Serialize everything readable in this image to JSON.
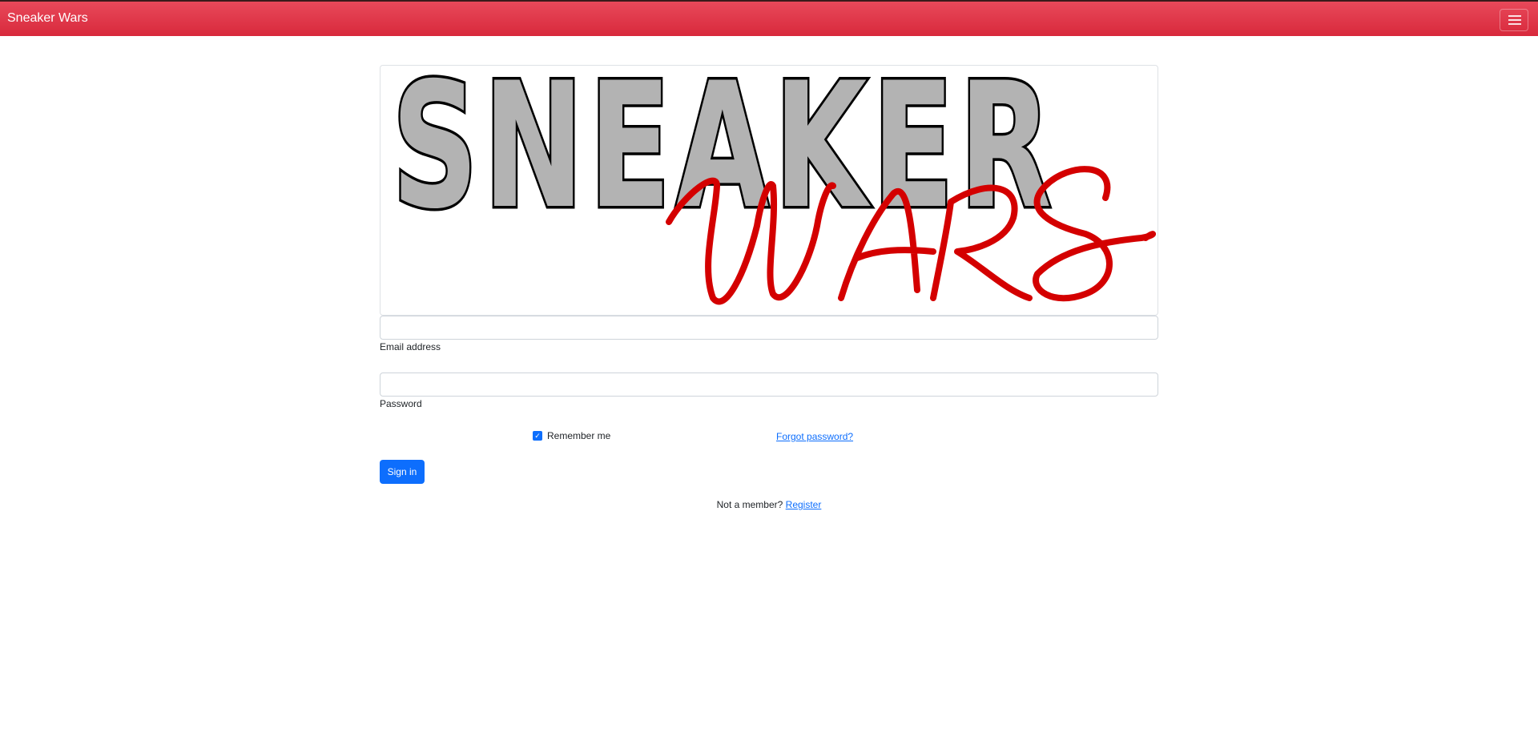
{
  "navbar": {
    "brand": "Sneaker Wars",
    "menu_icon": "hamburger-menu-icon",
    "color": "#dc3545"
  },
  "logo": {
    "word_top": "SNEAKER",
    "word_bottom": "WARS",
    "script_color": "#d40000"
  },
  "form": {
    "email": {
      "label": "Email address",
      "value": ""
    },
    "password": {
      "label": "Password",
      "value": ""
    },
    "remember": {
      "label": "Remember me",
      "checked": true
    },
    "forgot_link": "Forgot password?",
    "signin_button": "Sign in",
    "accent": "#0d6efd"
  },
  "footer": {
    "prompt": "Not a member?",
    "register_link": "Register"
  }
}
